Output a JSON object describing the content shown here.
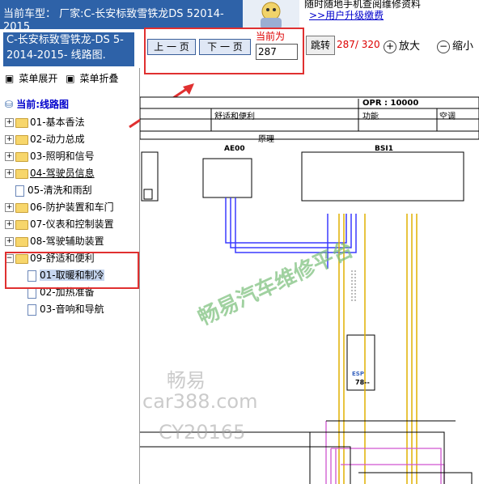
{
  "header": {
    "car_line1": "当前车型： 厂家:C-长安标致雪铁龙DS 52014-",
    "car_line2": "2015",
    "promo_line1": "随时随地手机查阅维修资料",
    "promo_link": ">>用户升级缴费"
  },
  "sidebar": {
    "title_line1": "C-长安标致雪铁龙-DS 5-",
    "title_line2": "2014-2015- 线路图.",
    "expand_label": "菜单展开",
    "collapse_label": "菜单折叠",
    "root_label": "当前:线路图",
    "items": [
      {
        "label": "01-基本香法"
      },
      {
        "label": "02-动力总成"
      },
      {
        "label": "03-照明和信号"
      },
      {
        "label": "04-驾驶员信息"
      },
      {
        "label": "05-清洗和雨刮"
      },
      {
        "label": "06-防护装置和车门"
      },
      {
        "label": "07-仪表和控制装置"
      },
      {
        "label": "08-驾驶辅助装置"
      },
      {
        "label": "09-舒适和便利"
      }
    ],
    "children": [
      {
        "label": "01-取暖和制冷"
      },
      {
        "label": "02-加热准备"
      },
      {
        "label": "03-音响和导航"
      }
    ]
  },
  "toolbar": {
    "prev_label": "上 一 页",
    "next_label": "下 一 页",
    "current_label": "当前为",
    "current_value": "287",
    "jump_label": "跳转",
    "page_indicator": "287/ 320",
    "zoom_in_label": "放大",
    "zoom_out_label": "缩小"
  },
  "diagram": {
    "opr": "OPR : 10000",
    "section": "舒适和便利",
    "function": "功能",
    "aircon": "空调",
    "principle": "原理",
    "ae00": "AE00",
    "bsi1": "BSI1",
    "esp": "ESP",
    "esp_num": "78--"
  },
  "watermarks": {
    "main": "畅易汽车维修平台",
    "w1": "畅易",
    "w2": "car388.com",
    "w3": "CY20165"
  }
}
